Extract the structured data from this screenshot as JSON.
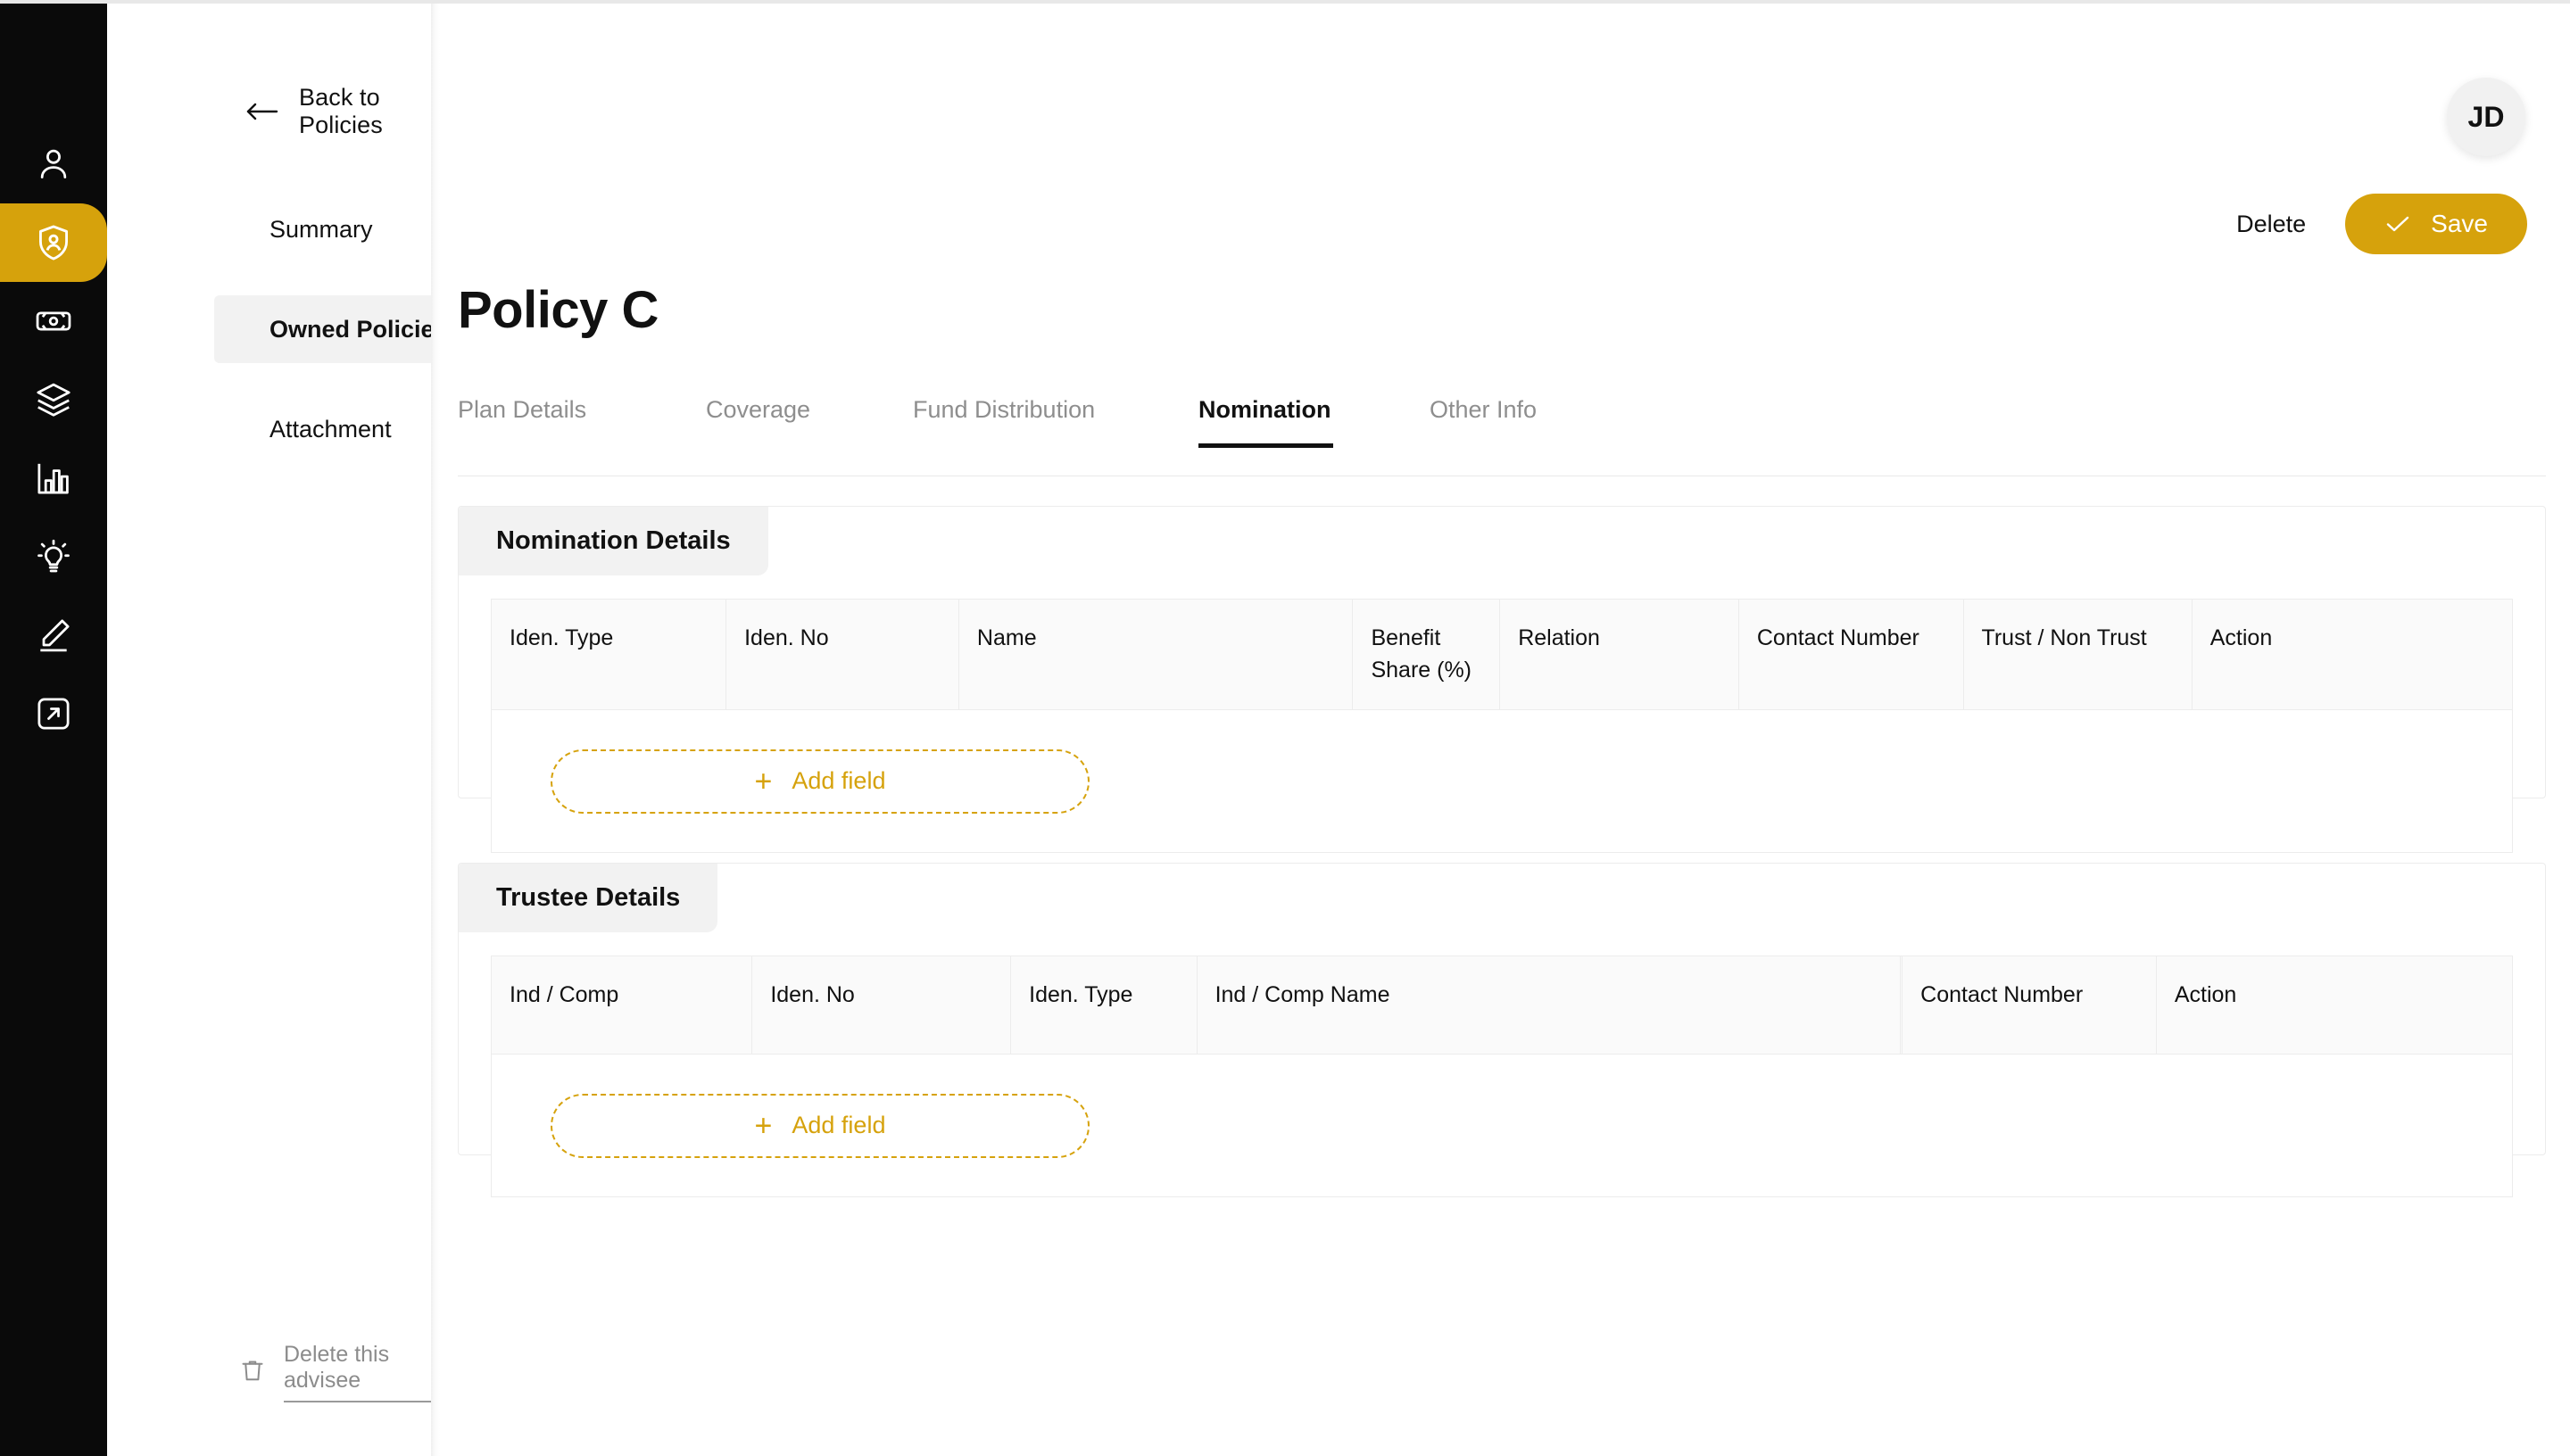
{
  "brand": {
    "accent": "#d6a20c",
    "rail_bg": "#0a0a0a",
    "badge_bg": "#f2f2f2"
  },
  "rail": {
    "items": [
      {
        "icon": "person-icon",
        "name": "rail-item-clients",
        "active": false
      },
      {
        "icon": "shield-user-icon",
        "name": "rail-item-policies",
        "active": true
      },
      {
        "icon": "banknote-icon",
        "name": "rail-item-finance",
        "active": false
      },
      {
        "icon": "layers-icon",
        "name": "rail-item-products",
        "active": false
      },
      {
        "icon": "bar-chart-icon",
        "name": "rail-item-reports",
        "active": false
      },
      {
        "icon": "lightbulb-icon",
        "name": "rail-item-insights",
        "active": false
      },
      {
        "icon": "pencil-icon",
        "name": "rail-item-notes",
        "active": false
      },
      {
        "icon": "logout-icon",
        "name": "rail-item-logout",
        "active": false
      }
    ]
  },
  "subnav": {
    "back_label": "Back to Policies",
    "back_icon": "arrow-left-icon",
    "items": [
      {
        "label": "Summary",
        "selected": false
      },
      {
        "label": "Owned Policies",
        "selected": true
      },
      {
        "label": "Attachment",
        "selected": false
      }
    ],
    "delete_advisee": {
      "label": "Delete this advisee",
      "icon": "trash-icon"
    }
  },
  "header": {
    "avatar_initials": "JD",
    "delete_label": "Delete",
    "save_label": "Save",
    "save_icon": "check-icon"
  },
  "page": {
    "title": "Policy C"
  },
  "tabs": [
    {
      "label": "Plan Details",
      "active": false
    },
    {
      "label": "Coverage",
      "active": false
    },
    {
      "label": "Fund Distribution",
      "active": false
    },
    {
      "label": "Nomination",
      "active": true
    },
    {
      "label": "Other Info",
      "active": false
    }
  ],
  "nomination": {
    "badge": "Nomination Details",
    "columns": [
      "Iden. Type",
      "Iden. No",
      "Name",
      "Benefit Share (%)",
      "Relation",
      "Contact Number",
      "Trust / Non Trust",
      "Action"
    ],
    "rows": [],
    "add_field_label": "Add field",
    "add_field_icon": "plus-icon"
  },
  "trustee": {
    "badge": "Trustee Details",
    "columns": [
      "Ind / Comp",
      "Iden. No",
      "Iden. Type",
      "Ind / Comp Name",
      "",
      "Contact Number",
      "Action"
    ],
    "rows": [],
    "add_field_label": "Add field",
    "add_field_icon": "plus-icon"
  }
}
